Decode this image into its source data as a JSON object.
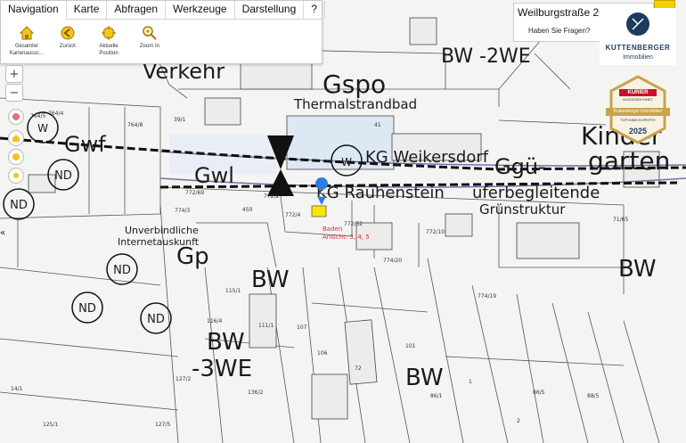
{
  "menu": [
    "Navigation",
    "Karte",
    "Abfragen",
    "Werkzeuge",
    "Darstellung",
    "?"
  ],
  "tools": [
    {
      "label": "Gesamter Kartenausschnitt",
      "icon": "home-icon"
    },
    {
      "label": "Zurück",
      "icon": "back-arrow-icon"
    },
    {
      "label": "Aktuelle Position",
      "icon": "location-icon"
    },
    {
      "label": "Zoom In",
      "icon": "zoom-in-icon"
    }
  ],
  "tools_display": [
    "Gesamter\nKartenaussc...",
    "Zurück",
    "Aktuelle\nPosition",
    "Zoom In"
  ],
  "address": {
    "street": "Weilburgstraße 26 ...",
    "question": "Haben Sie Fragen?"
  },
  "logo": {
    "brand": "KUTTENBERGER",
    "sub": "Immobilien"
  },
  "badge": {
    "head": "KURIER",
    "sub": "AUSGEZEICHNET",
    "ribbon": "Kuttenberger Immobilien",
    "top": "TOP IMMO EXPERTE",
    "year": "2025"
  },
  "marker": {
    "number": "1",
    "label_line1": "Baden",
    "label_line2": "Ansicht: 3, 4, 5"
  },
  "map_labels": {
    "verkehr": "Verkehr",
    "gspo": "Gspo",
    "thermalstrandbad": "Thermalstrandbad",
    "gwf": "Gwf",
    "gwl": "Gwl",
    "kg_weikersdorf": "KG Weikersdorf",
    "ggue": "Ggü-",
    "kg_rauhenstein": "KG Rauhenstein",
    "uferbegleitende": "uferbegleitende",
    "gruenstruktur": "Grünstruktur",
    "kinder": "Kinder",
    "garten": "garten",
    "bw_2we": "BW -2WE",
    "gp": "Gp",
    "unverbindliche": "Unverbindliche",
    "internetauskunft": "Internetauskunft",
    "bw": "BW",
    "bw_3we": "-3WE",
    "nd": "ND",
    "w": "W"
  },
  "parcels": [
    "772/69",
    "772/2",
    "772/4",
    "450",
    "772/52",
    "772/10",
    "774/3",
    "774/20",
    "115/1",
    "116/4",
    "111/1",
    "107",
    "106",
    "72",
    "101",
    "86/1",
    "1",
    "2",
    "86/5",
    "127/2",
    "136/2",
    "125/1",
    "14/1",
    "88/5",
    "127/5",
    "764/5",
    "39/1",
    "764/8",
    "71/65",
    "774/19",
    "764/4",
    "41"
  ],
  "colors": {
    "water": "#dde8f5",
    "road": "#7b6ea8",
    "marker": "#2f7be0",
    "accent": "#c8102e"
  }
}
